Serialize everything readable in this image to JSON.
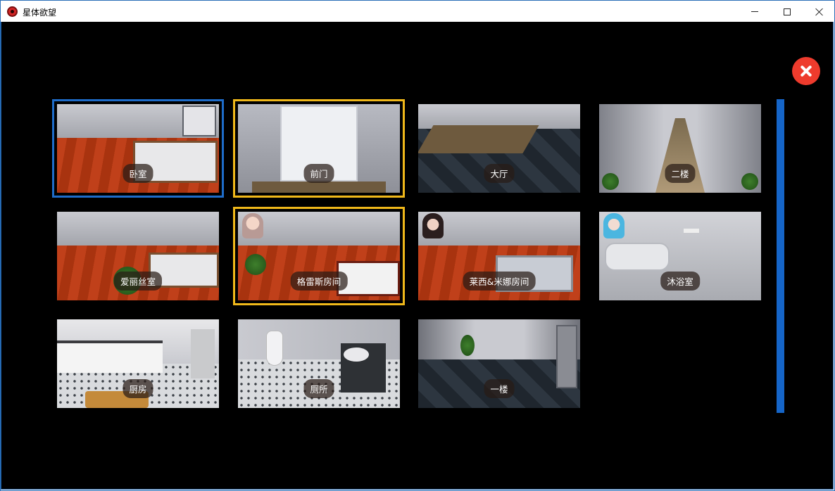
{
  "window": {
    "title": "星体欲望"
  },
  "colors": {
    "selected_blue": "#1e6cc9",
    "selected_gold": "#f0b81a",
    "exit_red": "#ee3b2d",
    "scroll_blue": "#1565c8"
  },
  "rooms": [
    {
      "label": "卧室",
      "state": "current",
      "has_character": false
    },
    {
      "label": "前门",
      "state": "highlighted",
      "has_character": false
    },
    {
      "label": "大厅",
      "state": "normal",
      "has_character": false
    },
    {
      "label": "二楼",
      "state": "normal",
      "has_character": false
    },
    {
      "label": "爱丽丝室",
      "state": "normal",
      "has_character": false
    },
    {
      "label": "格雷斯房间",
      "state": "highlighted",
      "has_character": true
    },
    {
      "label": "莱西&米娜房间",
      "state": "normal",
      "has_character": true
    },
    {
      "label": "沐浴室",
      "state": "normal",
      "has_character": true
    },
    {
      "label": "厨房",
      "state": "normal",
      "has_character": false
    },
    {
      "label": "厕所",
      "state": "normal",
      "has_character": false
    },
    {
      "label": "一楼",
      "state": "normal",
      "has_character": false
    }
  ]
}
